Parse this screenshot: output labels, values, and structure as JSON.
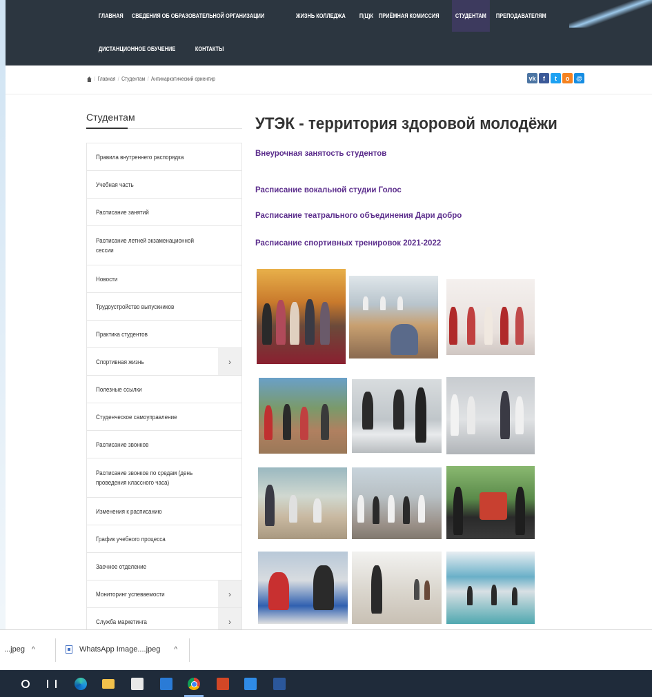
{
  "nav": {
    "row1": [
      "ГЛАВНАЯ",
      "СВЕДЕНИЯ ОБ ОБРАЗОВАТЕЛЬНОЙ ОРГАНИЗАЦИИ",
      "ЖИЗНЬ КОЛЛЕДЖА",
      "П(Ц)К",
      "ПРИЁМНАЯ КОМИССИЯ",
      "СТУДЕНТАМ",
      "ПРЕПОДАВАТЕЛЯМ"
    ],
    "row2": [
      "ДИСТАНЦИОННОЕ ОБУЧЕНИЕ",
      "КОНТАКТЫ"
    ],
    "active": "СТУДЕНТАМ"
  },
  "breadcrumb": [
    "Главная",
    "Студентам",
    "Антинаркотический ориентир"
  ],
  "share": {
    "vk": "vk",
    "fb": "f",
    "tw": "t",
    "ok": "o",
    "mm": "@"
  },
  "sidebar": {
    "title": "Студентам",
    "items": [
      {
        "label": "Правила внутреннего распорядка",
        "arrow": false
      },
      {
        "label": "Учебная часть",
        "arrow": false
      },
      {
        "label": "Расписание занятий",
        "arrow": false
      },
      {
        "label": "Расписание летней экзаменационной сессии",
        "arrow": false
      },
      {
        "label": "Новости",
        "arrow": false
      },
      {
        "label": "Трудоустройство выпускников",
        "arrow": false
      },
      {
        "label": "Практика студентов",
        "arrow": false
      },
      {
        "label": "Спортивная жизнь",
        "arrow": true
      },
      {
        "label": "Полезные ссылки",
        "arrow": false
      },
      {
        "label": "Студенческое самоуправление",
        "arrow": false
      },
      {
        "label": "Расписание звонков",
        "arrow": false
      },
      {
        "label": "Расписание звонков по средам (день проведения классного часа)",
        "arrow": false
      },
      {
        "label": "Изменения к расписанию",
        "arrow": false
      },
      {
        "label": "График учебного процесса",
        "arrow": false
      },
      {
        "label": "Заочное отделение",
        "arrow": false
      },
      {
        "label": "Мониторинг успеваемости",
        "arrow": true
      },
      {
        "label": "Служба маркетинга",
        "arrow": true
      }
    ]
  },
  "main": {
    "title": "УТЭК - территория здоровой молодёжи",
    "links": [
      "Внеурочная занятость студентов",
      "Расписание вокальной студии Голос",
      "Расписание театрального объединения Дари добро",
      "Расписание спортивных тренировок 2021-2022"
    ]
  },
  "downloads": {
    "item1": "...jpeg",
    "item2": "WhatsApp Image....jpeg",
    "chevron": "^"
  },
  "colors": {
    "nav_bg": "#2c3640",
    "nav_active": "#3d3a5e",
    "link": "#5b2d8c"
  }
}
